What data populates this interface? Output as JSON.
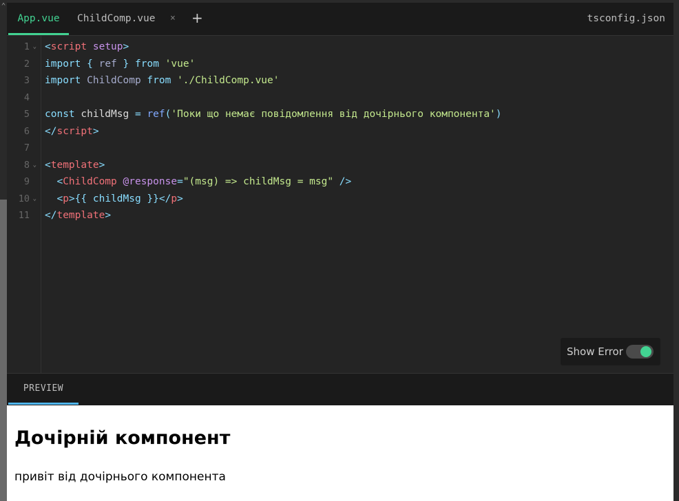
{
  "tabs": {
    "app": "App.vue",
    "child": "ChildComp.vue",
    "close_glyph": "×",
    "add_glyph": "+",
    "tsconfig": "tsconfig.json"
  },
  "editor": {
    "line_numbers": [
      "1",
      "2",
      "3",
      "4",
      "5",
      "6",
      "7",
      "8",
      "9",
      "10",
      "11"
    ],
    "fold_glyph": "⌄",
    "code": {
      "l1": {
        "open": "<",
        "tag": "script",
        "attr": " setup",
        "close": ">"
      },
      "l2": {
        "kw1": "import",
        "p1": " { ",
        "id": "ref",
        "p2": " } ",
        "kw2": "from",
        "sp": " ",
        "str": "'vue'"
      },
      "l3": {
        "kw1": "import",
        "id": " ChildComp ",
        "kw2": "from",
        "sp": " ",
        "str": "'./ChildComp.vue'"
      },
      "l5": {
        "kw": "const",
        "var": " childMsg ",
        "eq": "=",
        "sp": " ",
        "fn": "ref",
        "p1": "(",
        "str": "'Поки що немає повідомлення від дочірнього компонента'",
        "p2": ")"
      },
      "l6": {
        "open": "</",
        "tag": "script",
        "close": ">"
      },
      "l8": {
        "open": "<",
        "tag": "template",
        "close": ">"
      },
      "l9": {
        "indent": "  ",
        "open": "<",
        "tag": "ChildComp",
        "sp": " ",
        "attr": "@response",
        "eq": "=",
        "str": "\"(msg) => childMsg = msg\"",
        "close": " />"
      },
      "l10": {
        "indent": "  ",
        "open": "<",
        "tag": "p",
        "close": ">",
        "mustache": "{{ childMsg }}",
        "open2": "</",
        "tag2": "p",
        "close2": ">"
      },
      "l11": {
        "open": "</",
        "tag": "template",
        "close": ">"
      }
    },
    "show_error_label": "Show Error"
  },
  "preview": {
    "tab_label": "PREVIEW",
    "heading": "Дочірній компонент",
    "paragraph": "привіт від дочірнього компонента"
  },
  "colors": {
    "accent": "#42d392",
    "preview_accent": "#4fb6ee"
  }
}
